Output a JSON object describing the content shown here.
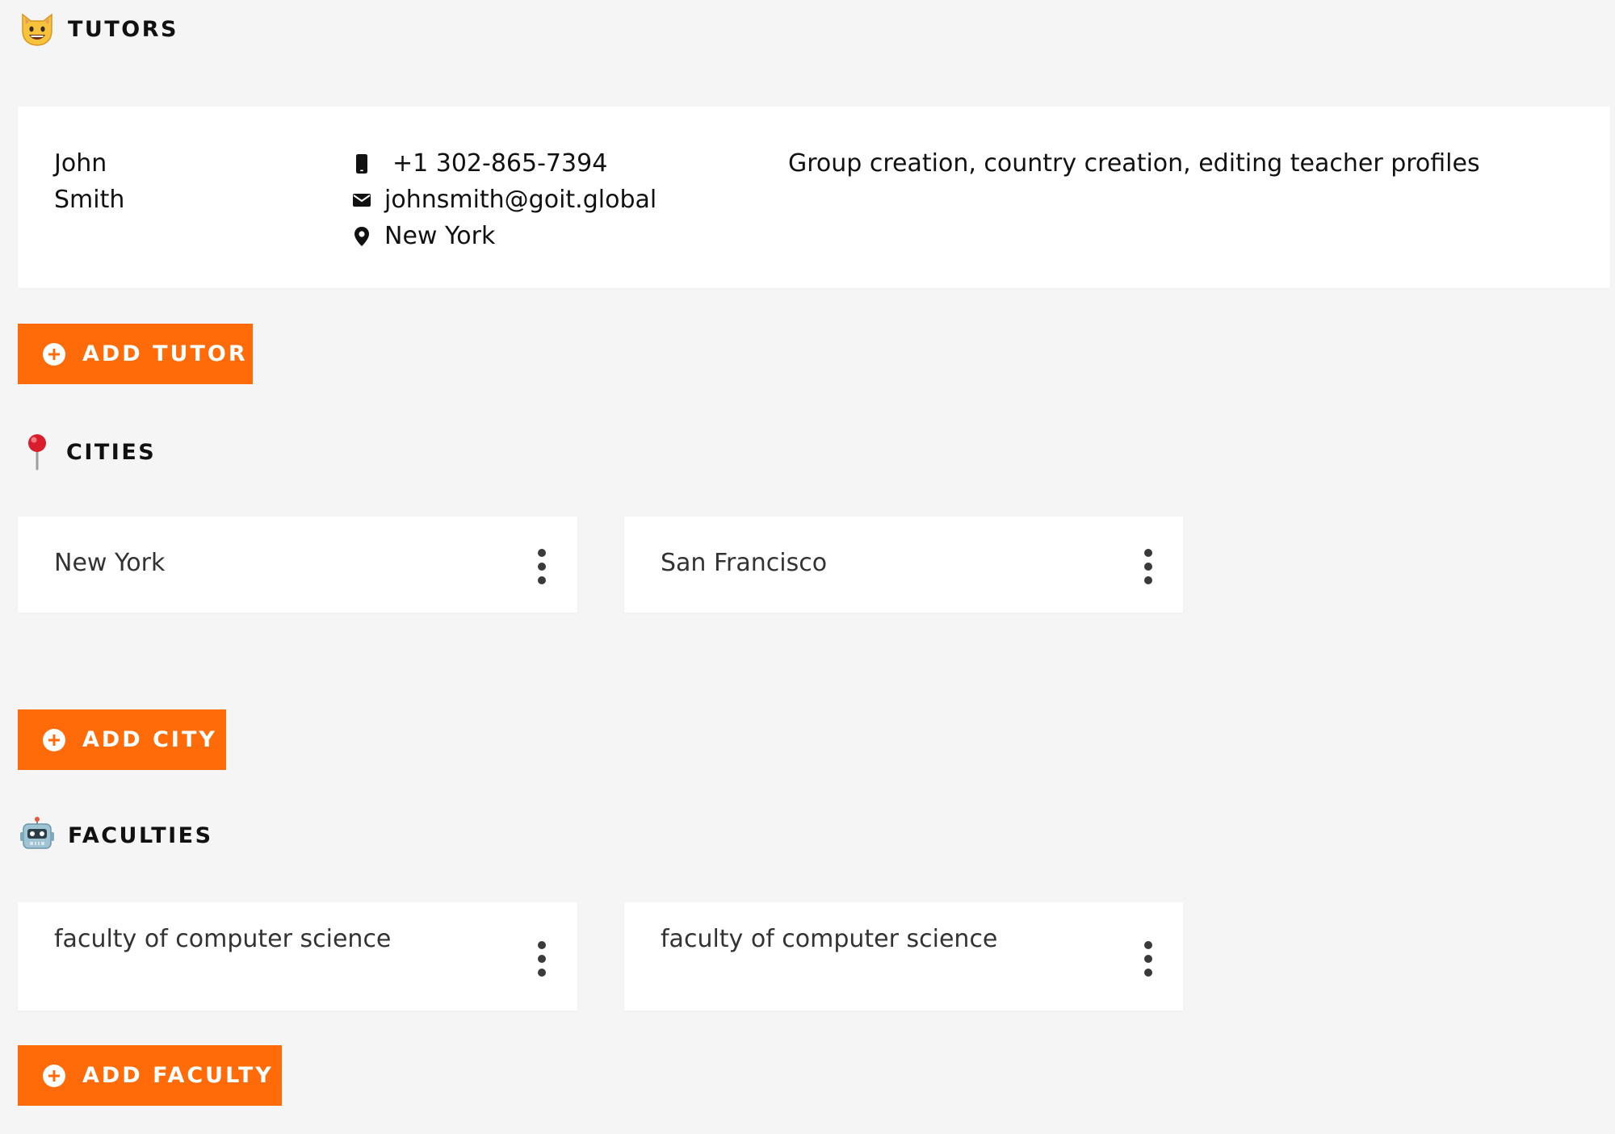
{
  "tutors": {
    "title": "TUTORS",
    "icon": "cat-face-icon",
    "items": [
      {
        "first_name": "John",
        "last_name": "Smith",
        "phone": "+1 302-865-7394",
        "email": "johnsmith@goit.global",
        "city": "New York",
        "options": "Group creation, country creation, editing teacher profiles"
      }
    ],
    "add_label": "ADD TUTOR"
  },
  "cities": {
    "title": "CITIES",
    "icon": "pushpin-icon",
    "items": [
      {
        "name": "New York"
      },
      {
        "name": "San Francisco"
      }
    ],
    "add_label": "ADD CITY"
  },
  "faculties": {
    "title": "FACULTIES",
    "icon": "robot-icon",
    "items": [
      {
        "name": "faculty of computer science"
      },
      {
        "name": "faculty of computer science"
      }
    ],
    "add_label": "ADD FACULTY"
  },
  "colors": {
    "accent": "#ff6b08",
    "background": "#f5f5f5",
    "card": "#ffffff"
  }
}
